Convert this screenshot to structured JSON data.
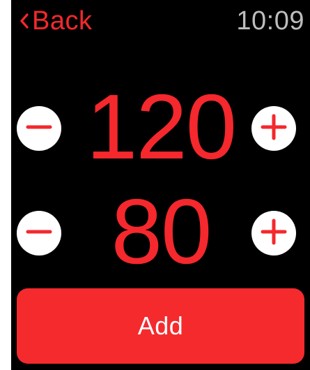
{
  "header": {
    "back_label": "Back",
    "time": "10:09"
  },
  "systolic": {
    "value": "120"
  },
  "diastolic": {
    "value": "80"
  },
  "actions": {
    "add_label": "Add"
  },
  "icons": {
    "back": "chevron-left-icon",
    "decrement": "minus-icon",
    "increment": "plus-icon"
  },
  "colors": {
    "accent": "#f4282d",
    "background": "#000000",
    "button_fill": "#ffffff",
    "time_text": "#bdbdbd"
  }
}
